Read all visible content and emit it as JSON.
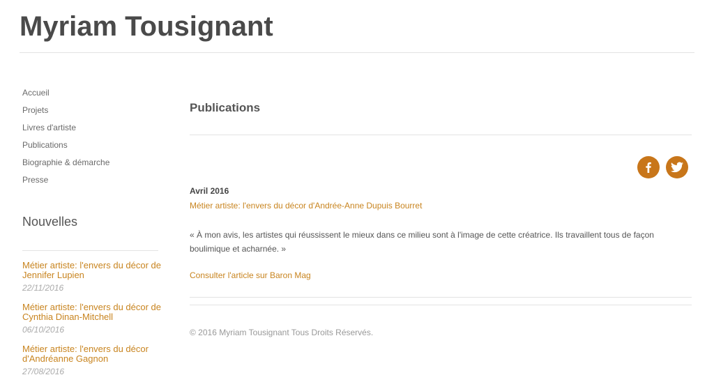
{
  "site": {
    "title": "Myriam Tousignant"
  },
  "nav": {
    "items": [
      {
        "label": "Accueil"
      },
      {
        "label": "Projets"
      },
      {
        "label": "Livres d'artiste"
      },
      {
        "label": "Publications"
      },
      {
        "label": "Biographie & démarche"
      },
      {
        "label": "Presse"
      }
    ]
  },
  "news": {
    "title": "Nouvelles",
    "items": [
      {
        "title": "Métier artiste: l'envers du décor de Jennifer Lupien",
        "date": "22/11/2016"
      },
      {
        "title": "Métier artiste: l'envers du décor de Cynthia Dinan-Mitchell",
        "date": "06/10/2016"
      },
      {
        "title": "Métier artiste: l'envers du décor d'Andréanne Gagnon",
        "date": "27/08/2016"
      }
    ]
  },
  "main": {
    "title": "Publications",
    "social": {
      "facebook_icon": "facebook-icon",
      "twitter_icon": "twitter-icon",
      "color": "#c8761a"
    },
    "publication": {
      "date": "Avril 2016",
      "link": "Métier artiste: l'envers du décor d'Andrée-Anne Dupuis Bourret",
      "quote": "« À mon avis, les artistes qui réussissent le mieux dans ce milieu sont à l'image de cette créatrice. Ils travaillent tous de façon boulimique et acharnée. »",
      "consult": "Consulter l'article sur Baron Mag"
    }
  },
  "footer": {
    "copyright": "© 2016 Myriam Tousignant Tous Droits Réservés."
  },
  "colors": {
    "accent": "#c8841f",
    "text": "#555555",
    "rule": "#e3e3e3"
  }
}
